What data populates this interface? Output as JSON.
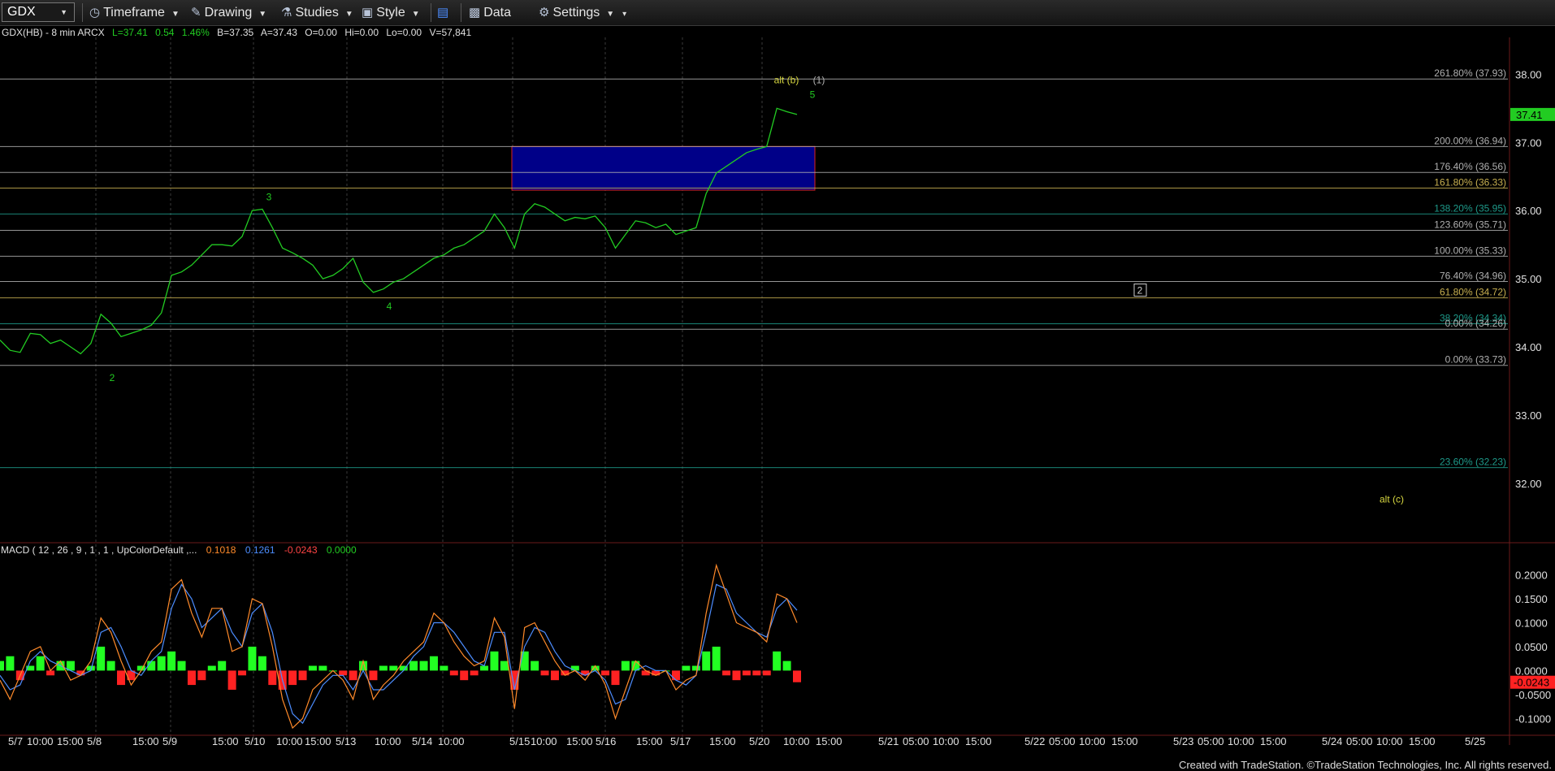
{
  "toolbar": {
    "symbol": "GDX",
    "timeframe": "Timeframe",
    "drawing": "Drawing",
    "studies": "Studies",
    "style": "Style",
    "data": "Data",
    "settings": "Settings"
  },
  "header": {
    "symbol_info": "GDX(HB) - 8 min  ARCX",
    "last": "L=37.41",
    "change": "0.54",
    "change_pct": "1.46%",
    "bid": "B=37.35",
    "ask": "A=37.43",
    "open": "O=0.00",
    "high": "Hi=0.00",
    "low": "Lo=0.00",
    "volume": "V=57,841"
  },
  "footer": "Created with TradeStation. ©TradeStation Technologies, Inc. All rights reserved.",
  "colors": {
    "price": "#22cc22",
    "box_fill": "#000088",
    "box_border": "#dd2222",
    "macd_line": "#ff8a2a",
    "signal_line": "#4c8dff",
    "hist_pos": "#22ff22",
    "hist_neg": "#ff2222",
    "last_price_bg": "#22cc22"
  },
  "chart_data": {
    "type": "line",
    "title": "",
    "price_axis": {
      "ylim": [
        31.2,
        38.35
      ],
      "ticks": [
        "38.00",
        "37.00",
        "36.00",
        "35.00",
        "34.00",
        "33.00",
        "32.00"
      ],
      "tick_values": [
        38,
        37,
        36,
        35,
        34,
        33,
        32
      ]
    },
    "last_price_label": "37.41",
    "last_price_value": 37.41,
    "x_ticks": [
      "5/7",
      "10:00",
      "15:00",
      "5/8",
      "15:00",
      "5/9",
      "15:00",
      "5/10",
      "10:00",
      "15:00",
      "5/13",
      "10:00",
      "5/14",
      "10:00",
      "5/15",
      "10:00",
      "15:00",
      "5/16",
      "15:00",
      "5/17",
      "15:00",
      "5/20",
      "10:00",
      "15:00",
      "5/21",
      "05:00",
      "10:00",
      "15:00",
      "5/22",
      "05:00",
      "10:00",
      "15:00",
      "5/23",
      "05:00",
      "10:00",
      "15:00",
      "5/24",
      "05:00",
      "10:00",
      "15:00",
      "5/25"
    ],
    "price_series": {
      "name": "GDX",
      "values": [
        34.1,
        33.95,
        33.92,
        34.2,
        34.18,
        34.05,
        34.1,
        34.0,
        33.9,
        34.05,
        34.48,
        34.35,
        34.15,
        34.2,
        34.25,
        34.32,
        34.5,
        35.05,
        35.1,
        35.2,
        35.35,
        35.5,
        35.5,
        35.48,
        35.62,
        36.0,
        36.02,
        35.75,
        35.45,
        35.38,
        35.3,
        35.2,
        35.0,
        35.05,
        35.15,
        35.3,
        34.95,
        34.8,
        34.85,
        34.95,
        35.0,
        35.1,
        35.2,
        35.3,
        35.35,
        35.45,
        35.5,
        35.6,
        35.7,
        35.95,
        35.75,
        35.45,
        35.95,
        36.1,
        36.05,
        35.95,
        35.85,
        35.9,
        35.88,
        35.92,
        35.75,
        35.45,
        35.65,
        35.85,
        35.82,
        35.75,
        35.8,
        35.65,
        35.7,
        35.75,
        36.25,
        36.55,
        36.65,
        36.75,
        36.85,
        36.9,
        36.94,
        37.5,
        37.45,
        37.41
      ],
      "x_range": [
        0.0,
        981.0
      ]
    },
    "fib_levels": [
      {
        "label": "261.80% (37.93)",
        "value": 37.93,
        "color": "#b0b0b0"
      },
      {
        "label": "200.00% (36.94)",
        "value": 36.94,
        "color": "#b0b0b0"
      },
      {
        "label": "176.40% (36.56)",
        "value": 36.56,
        "color": "#b0b0b0"
      },
      {
        "label": "161.80% (36.33)",
        "value": 36.33,
        "color": "#c8b050"
      },
      {
        "label": "138.20% (35.95)",
        "value": 35.95,
        "color": "#1e9a8a"
      },
      {
        "label": "123.60% (35.71)",
        "value": 35.71,
        "color": "#b0b0b0"
      },
      {
        "label": "100.00% (35.33)",
        "value": 35.33,
        "color": "#b0b0b0"
      },
      {
        "label": "76.40% (34.96)",
        "value": 34.96,
        "color": "#b0b0b0"
      },
      {
        "label": "61.80% (34.72)",
        "value": 34.72,
        "color": "#c8b050"
      },
      {
        "label": "38.20% (34.34)",
        "value": 34.34,
        "color": "#1e9a8a"
      },
      {
        "label": "0.00% (34.26)",
        "value": 34.26,
        "color": "#b0b0b0"
      },
      {
        "label": "0.00% (33.73)",
        "value": 33.73,
        "color": "#b0b0b0"
      },
      {
        "label": "23.60% (32.23)",
        "value": 32.23,
        "color": "#1e9a8a"
      }
    ],
    "target_box": {
      "x_from": 630.0,
      "x_to": 1003.0,
      "top": 36.94,
      "bottom": 36.3
    },
    "wave_labels": [
      {
        "text": "2",
        "x": 138.0,
        "y": 33.5,
        "color": "#22cc22"
      },
      {
        "text": "3",
        "x": 331.0,
        "y": 36.15,
        "color": "#22cc22"
      },
      {
        "text": "4",
        "x": 479.0,
        "y": 34.55,
        "color": "#22cc22"
      },
      {
        "text": "5",
        "x": 1000.0,
        "y": 37.65,
        "color": "#22cc22"
      },
      {
        "text": "alt (b)",
        "x": 968.0,
        "y": 37.87,
        "color": "#d6d640"
      },
      {
        "text": "(1)",
        "x": 1008.0,
        "y": 37.87,
        "color": "#b0b0b0"
      },
      {
        "text": "2",
        "x": 1403.0,
        "y": 34.78,
        "color": "#cccccc",
        "boxed": true
      },
      {
        "text": "alt (c)",
        "x": 1713.0,
        "y": 31.72,
        "color": "#d6d640"
      }
    ],
    "macd": {
      "label": "MACD ( 12 , 26 , 9 , 1 , 1 , UpColorDefault ,...",
      "readouts": [
        "0.1018",
        "0.1261",
        "-0.0243",
        "0.0000"
      ],
      "readout_colors": [
        "#ff8a2a",
        "#4c8dff",
        "#ff4444",
        "#22cc22"
      ],
      "ylim": [
        -0.13,
        0.24
      ],
      "ticks": [
        "0.2000",
        "0.1500",
        "0.1000",
        "0.0500",
        "0.0000",
        "-0.0500",
        "-0.1000"
      ],
      "tick_values": [
        0.2,
        0.15,
        0.1,
        0.05,
        0.0,
        -0.05,
        -0.1
      ],
      "last_value_label": "-0.0243",
      "last_value": -0.0243,
      "macd_line": [
        -0.02,
        -0.06,
        -0.01,
        0.04,
        0.05,
        0.0,
        0.02,
        -0.02,
        -0.01,
        0.02,
        0.11,
        0.08,
        0.02,
        -0.03,
        0.0,
        0.04,
        0.06,
        0.17,
        0.19,
        0.12,
        0.07,
        0.13,
        0.13,
        0.04,
        0.05,
        0.15,
        0.14,
        0.05,
        -0.06,
        -0.12,
        -0.1,
        -0.04,
        -0.02,
        0.0,
        -0.02,
        -0.06,
        0.02,
        -0.06,
        -0.03,
        -0.01,
        0.02,
        0.04,
        0.06,
        0.12,
        0.1,
        0.06,
        0.03,
        0.01,
        0.02,
        0.11,
        0.07,
        -0.08,
        0.09,
        0.1,
        0.06,
        0.02,
        -0.01,
        0.0,
        -0.02,
        0.01,
        -0.03,
        -0.1,
        -0.04,
        0.02,
        0.0,
        -0.01,
        0.0,
        -0.04,
        -0.02,
        -0.01,
        0.12,
        0.22,
        0.16,
        0.1,
        0.09,
        0.08,
        0.06,
        0.16,
        0.15,
        0.1
      ],
      "signal_line": [
        -0.01,
        -0.04,
        -0.03,
        0.02,
        0.04,
        0.02,
        0.01,
        0.0,
        -0.01,
        0.0,
        0.08,
        0.09,
        0.05,
        0.0,
        -0.01,
        0.02,
        0.04,
        0.13,
        0.18,
        0.15,
        0.09,
        0.11,
        0.13,
        0.08,
        0.05,
        0.12,
        0.14,
        0.08,
        -0.02,
        -0.09,
        -0.11,
        -0.07,
        -0.03,
        -0.01,
        -0.01,
        -0.04,
        0.0,
        -0.04,
        -0.04,
        -0.02,
        0.0,
        0.03,
        0.05,
        0.1,
        0.1,
        0.08,
        0.05,
        0.02,
        0.01,
        0.08,
        0.08,
        -0.04,
        0.05,
        0.09,
        0.08,
        0.04,
        0.01,
        0.0,
        -0.01,
        0.0,
        -0.02,
        -0.07,
        -0.06,
        0.0,
        0.01,
        0.0,
        0.0,
        -0.02,
        -0.03,
        -0.01,
        0.08,
        0.18,
        0.17,
        0.12,
        0.1,
        0.08,
        0.07,
        0.13,
        0.15,
        0.126
      ],
      "histogram": [
        0.02,
        0.03,
        -0.02,
        0.01,
        0.03,
        -0.01,
        0.02,
        0.02,
        -0.01,
        0.01,
        0.05,
        0.02,
        -0.03,
        -0.02,
        0.01,
        0.02,
        0.03,
        0.04,
        0.02,
        -0.03,
        -0.02,
        0.01,
        0.02,
        -0.04,
        -0.01,
        0.05,
        0.03,
        -0.03,
        -0.04,
        -0.03,
        -0.02,
        0.01,
        0.01,
        0.0,
        -0.01,
        -0.02,
        0.02,
        -0.02,
        0.01,
        0.01,
        0.01,
        0.02,
        0.02,
        0.03,
        0.01,
        -0.01,
        -0.02,
        -0.01,
        0.01,
        0.04,
        0.02,
        -0.04,
        0.04,
        0.02,
        -0.01,
        -0.02,
        -0.01,
        0.01,
        -0.01,
        0.01,
        -0.01,
        -0.03,
        0.02,
        0.02,
        -0.01,
        -0.01,
        0.0,
        -0.02,
        0.01,
        0.01,
        0.04,
        0.05,
        -0.01,
        -0.02,
        -0.01,
        -0.01,
        -0.01,
        0.04,
        0.02,
        -0.0243
      ]
    }
  }
}
